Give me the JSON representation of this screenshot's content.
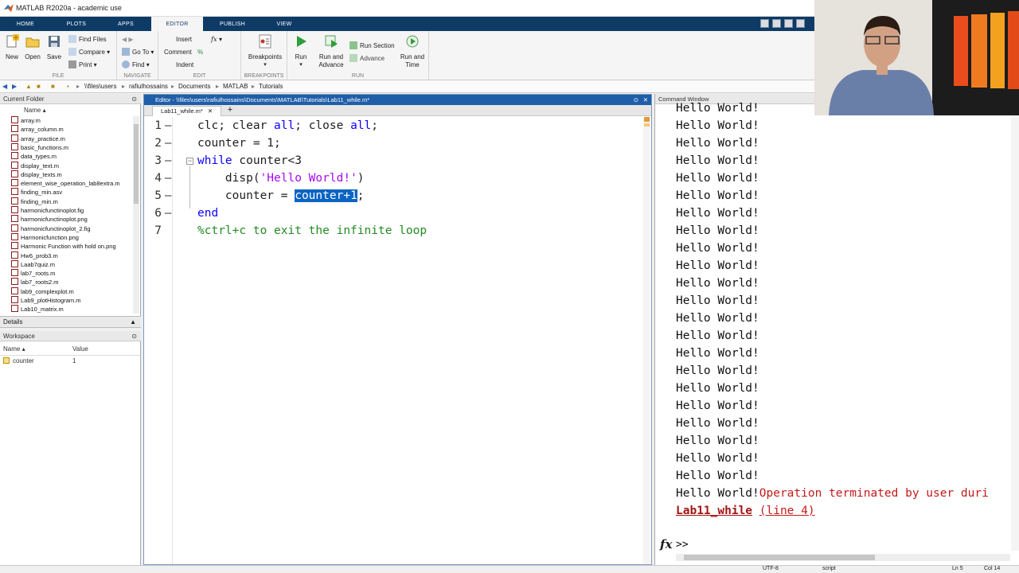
{
  "window": {
    "title": "MATLAB R2020a - academic use"
  },
  "tabs": [
    "HOME",
    "PLOTS",
    "APPS",
    "EDITOR",
    "PUBLISH",
    "VIEW"
  ],
  "ribbon": {
    "file": {
      "group": "FILE",
      "new": "New",
      "open": "Open",
      "save": "Save",
      "find_files": "Find Files",
      "compare": "Compare",
      "print": "Print"
    },
    "navigate": {
      "group": "NAVIGATE",
      "goto": "Go To",
      "find": "Find"
    },
    "edit": {
      "group": "EDIT",
      "insert": "Insert",
      "comment": "Comment",
      "indent": "Indent"
    },
    "breakpoints": {
      "group": "BREAKPOINTS",
      "breakpoints": "Breakpoints"
    },
    "run": {
      "group": "RUN",
      "run": "Run",
      "run_advance_1": "Run and",
      "run_advance_2": "Advance",
      "run_section": "Run Section",
      "advance": "Advance",
      "run_time_1": "Run and",
      "run_time_2": "Time"
    }
  },
  "address": [
    "\\\\files\\users",
    "rafiulhossains",
    "Documents",
    "MATLAB",
    "Tutorials"
  ],
  "current_folder": {
    "title": "Current Folder",
    "col_name": "Name",
    "files": [
      "array.m",
      "array_column.m",
      "array_practice.m",
      "basic_functions.m",
      "data_types.m",
      "display_text.m",
      "display_texts.m",
      "element_wise_operation_lab8extra.m",
      "finding_min.asv",
      "finding_min.m",
      "harmonicfunctinoplot.fig",
      "harmonicfunctinoplot.png",
      "harmonicfunctinoplot_2.fig",
      "Harmonicfunction.png",
      "Harmonic Function with hold on.png",
      "Hw6_prob3.m",
      "Laab7quiz.m",
      "lab7_roots.m",
      "lab7_roots2.m",
      "lab9_complexplot.m",
      "Lab9_plotHistogram.m",
      "Lab10_matrix.m"
    ]
  },
  "details": {
    "title": "Details"
  },
  "workspace": {
    "title": "Workspace",
    "col_name": "Name",
    "col_value": "Value",
    "vars": [
      {
        "name": "counter",
        "value": "1"
      }
    ]
  },
  "editor": {
    "header": "Editor - \\\\files\\users\\rafiulhossains\\Documents\\MATLAB\\Tutorials\\Lab11_while.m*",
    "tab": "Lab11_while.m*",
    "add_tab": "+",
    "lines": [
      {
        "num": "1",
        "parts": [
          "clc; clear ",
          "all",
          "; close ",
          "all",
          ";"
        ]
      },
      {
        "num": "2",
        "parts": [
          "counter = 1;"
        ]
      },
      {
        "num": "3",
        "parts": [
          "while",
          " counter<3"
        ]
      },
      {
        "num": "4",
        "parts": [
          "    disp(",
          "'Hello World!'",
          ")"
        ]
      },
      {
        "num": "5",
        "parts": [
          "    counter = ",
          "counter+1",
          ";"
        ]
      },
      {
        "num": "6",
        "parts": [
          "end"
        ]
      },
      {
        "num": "7",
        "parts": [
          "%ctrl+c to exit the infinite loop"
        ]
      }
    ]
  },
  "command_window": {
    "title": "Command Window",
    "output_line": "Hello World!",
    "output_count": 22,
    "last_line_prefix": "Hello World!",
    "error_msg": "Operation terminated by user duri",
    "error_func": "Lab11_while",
    "error_line": "(line 4)",
    "fx": "fx",
    "prompt": ">>"
  },
  "status": {
    "encoding": "UTF-8",
    "mode": "script",
    "ln": "Ln  5",
    "col": "Col  14"
  }
}
